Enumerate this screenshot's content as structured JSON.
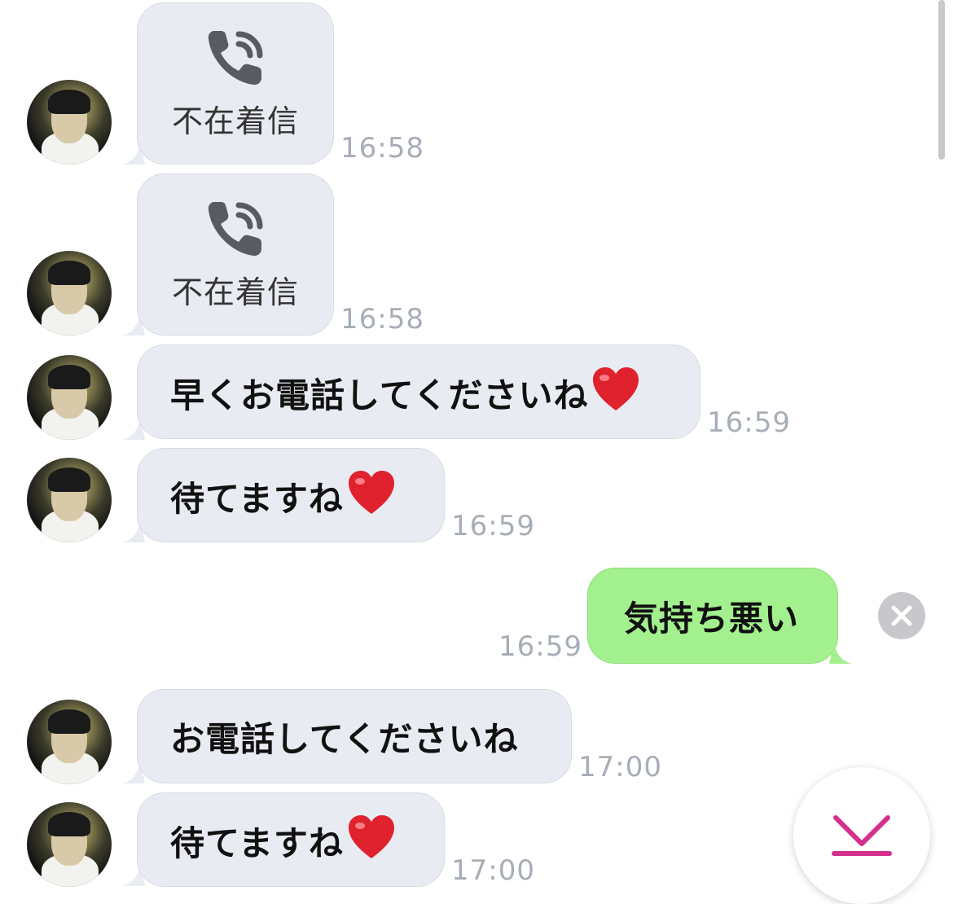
{
  "messages": [
    {
      "type": "call",
      "label": "不在着信",
      "time": "16:58"
    },
    {
      "type": "call",
      "label": "不在着信",
      "time": "16:58"
    },
    {
      "type": "text",
      "text": "早くお電話してくださいね",
      "heart": true,
      "time": "16:59"
    },
    {
      "type": "text",
      "text": "待てますね",
      "heart": true,
      "time": "16:59"
    },
    {
      "type": "sent",
      "text": "気持ち悪い",
      "time": "16:59",
      "status": "send-failed"
    },
    {
      "type": "text",
      "text": "お電話してくださいね",
      "heart": false,
      "time": "17:00"
    },
    {
      "type": "text",
      "text": "待てますね",
      "heart": true,
      "time": "17:00"
    }
  ],
  "icons": {
    "call": "phone-missed-icon",
    "heart": "red-heart-icon",
    "error": "close-circle-icon",
    "scroll": "scroll-to-bottom-icon"
  },
  "colors": {
    "incoming_bubble": "#e9ebf2",
    "outgoing_bubble": "#a3f08e",
    "timestamp": "#a7adb7",
    "heart": "#e0212e",
    "scroll_icon": "#d4308e"
  }
}
